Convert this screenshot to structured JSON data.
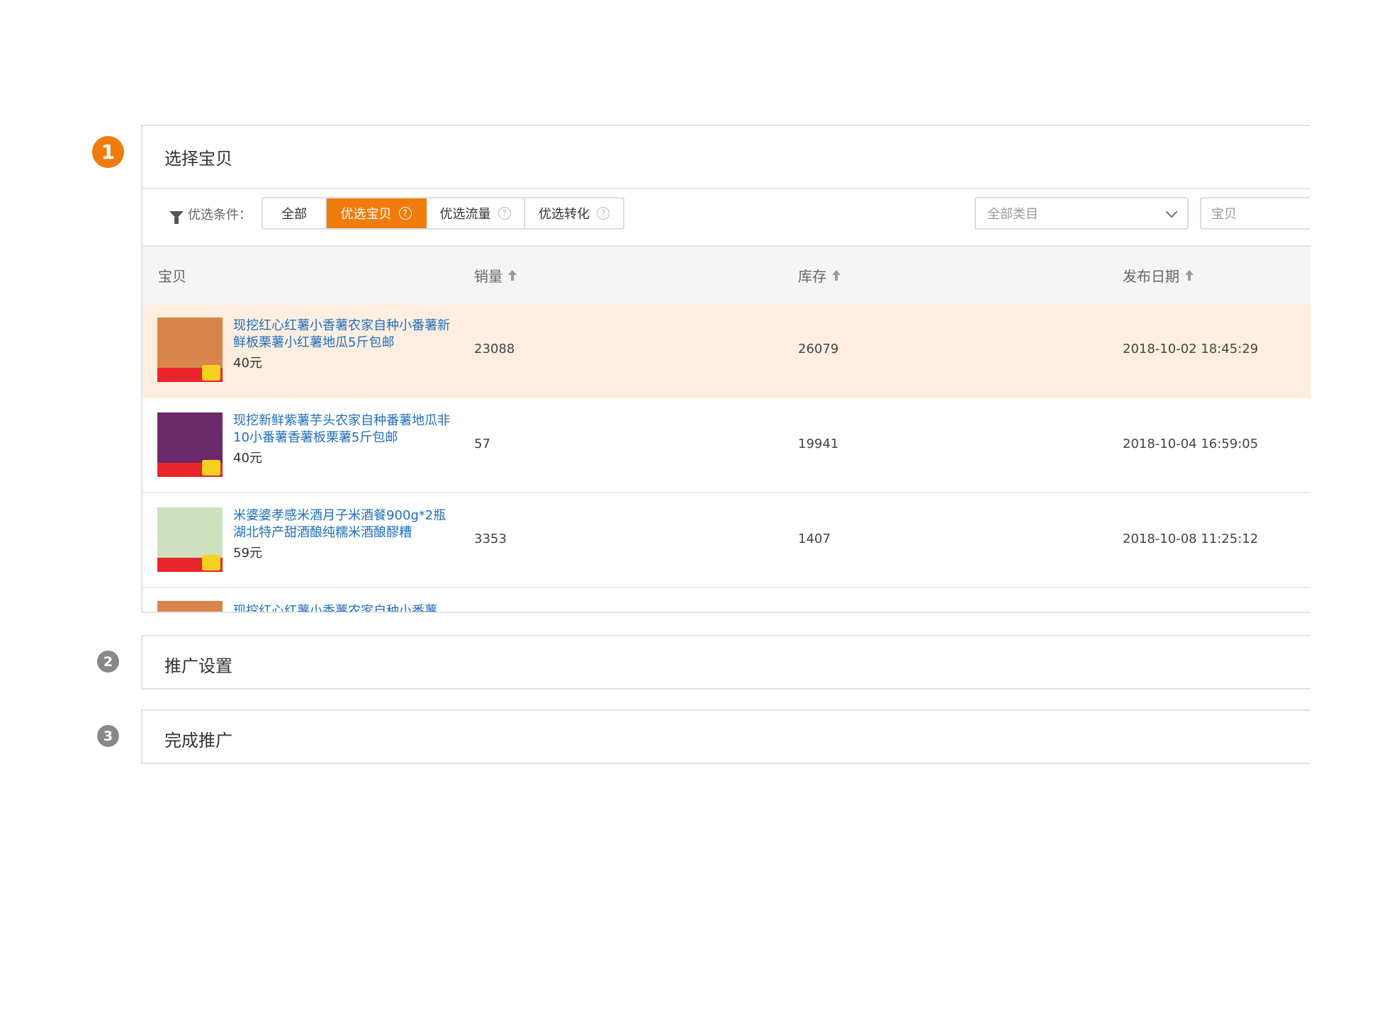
{
  "steps": [
    {
      "number": "1",
      "title": "选择宝贝"
    },
    {
      "number": "2",
      "title": "推广设置"
    },
    {
      "number": "3",
      "title": "完成推广"
    }
  ],
  "filter": {
    "label": "优选条件：",
    "options": [
      {
        "label": "全部",
        "help": false
      },
      {
        "label": "优选宝贝",
        "help": true
      },
      {
        "label": "优选流量",
        "help": true
      },
      {
        "label": "优选转化",
        "help": true
      }
    ],
    "active_index": 1,
    "help_glyph": "?",
    "category_select": "全部类目",
    "search_placeholder": "宝贝"
  },
  "table": {
    "columns": {
      "item": "宝贝",
      "sales": "销量",
      "stock": "库存",
      "publish_date": "发布日期"
    },
    "rows": [
      {
        "title": "现挖红心红薯小香薯农家自种小番薯新鲜板栗薯小红薯地瓜5斤包邮",
        "price": "40元",
        "sales": "23088",
        "stock": "26079",
        "publish_date": "2018-10-02 18:45:29",
        "thumb_color": "#d9844a",
        "highlighted": true
      },
      {
        "title": "现挖新鲜紫薯芋头农家自种番薯地瓜非10小番薯香薯板栗薯5斤包邮",
        "price": "40元",
        "sales": "57",
        "stock": "19941",
        "publish_date": "2018-10-04 16:59:05",
        "thumb_color": "#6b2a6a",
        "highlighted": false
      },
      {
        "title": "米婆婆孝感米酒月子米酒餐900g*2瓶湖北特产甜酒酿纯糯米酒酿醪糟",
        "price": "59元",
        "sales": "3353",
        "stock": "1407",
        "publish_date": "2018-10-08 11:25:12",
        "thumb_color": "#cfe0c0",
        "highlighted": false
      }
    ],
    "partial_row_title": "现挖红心红薯小香薯农家自种小番薯"
  },
  "colors": {
    "accent": "#f07c0c",
    "link": "#1f6fbf",
    "row_highlight": "#fdeee0"
  }
}
